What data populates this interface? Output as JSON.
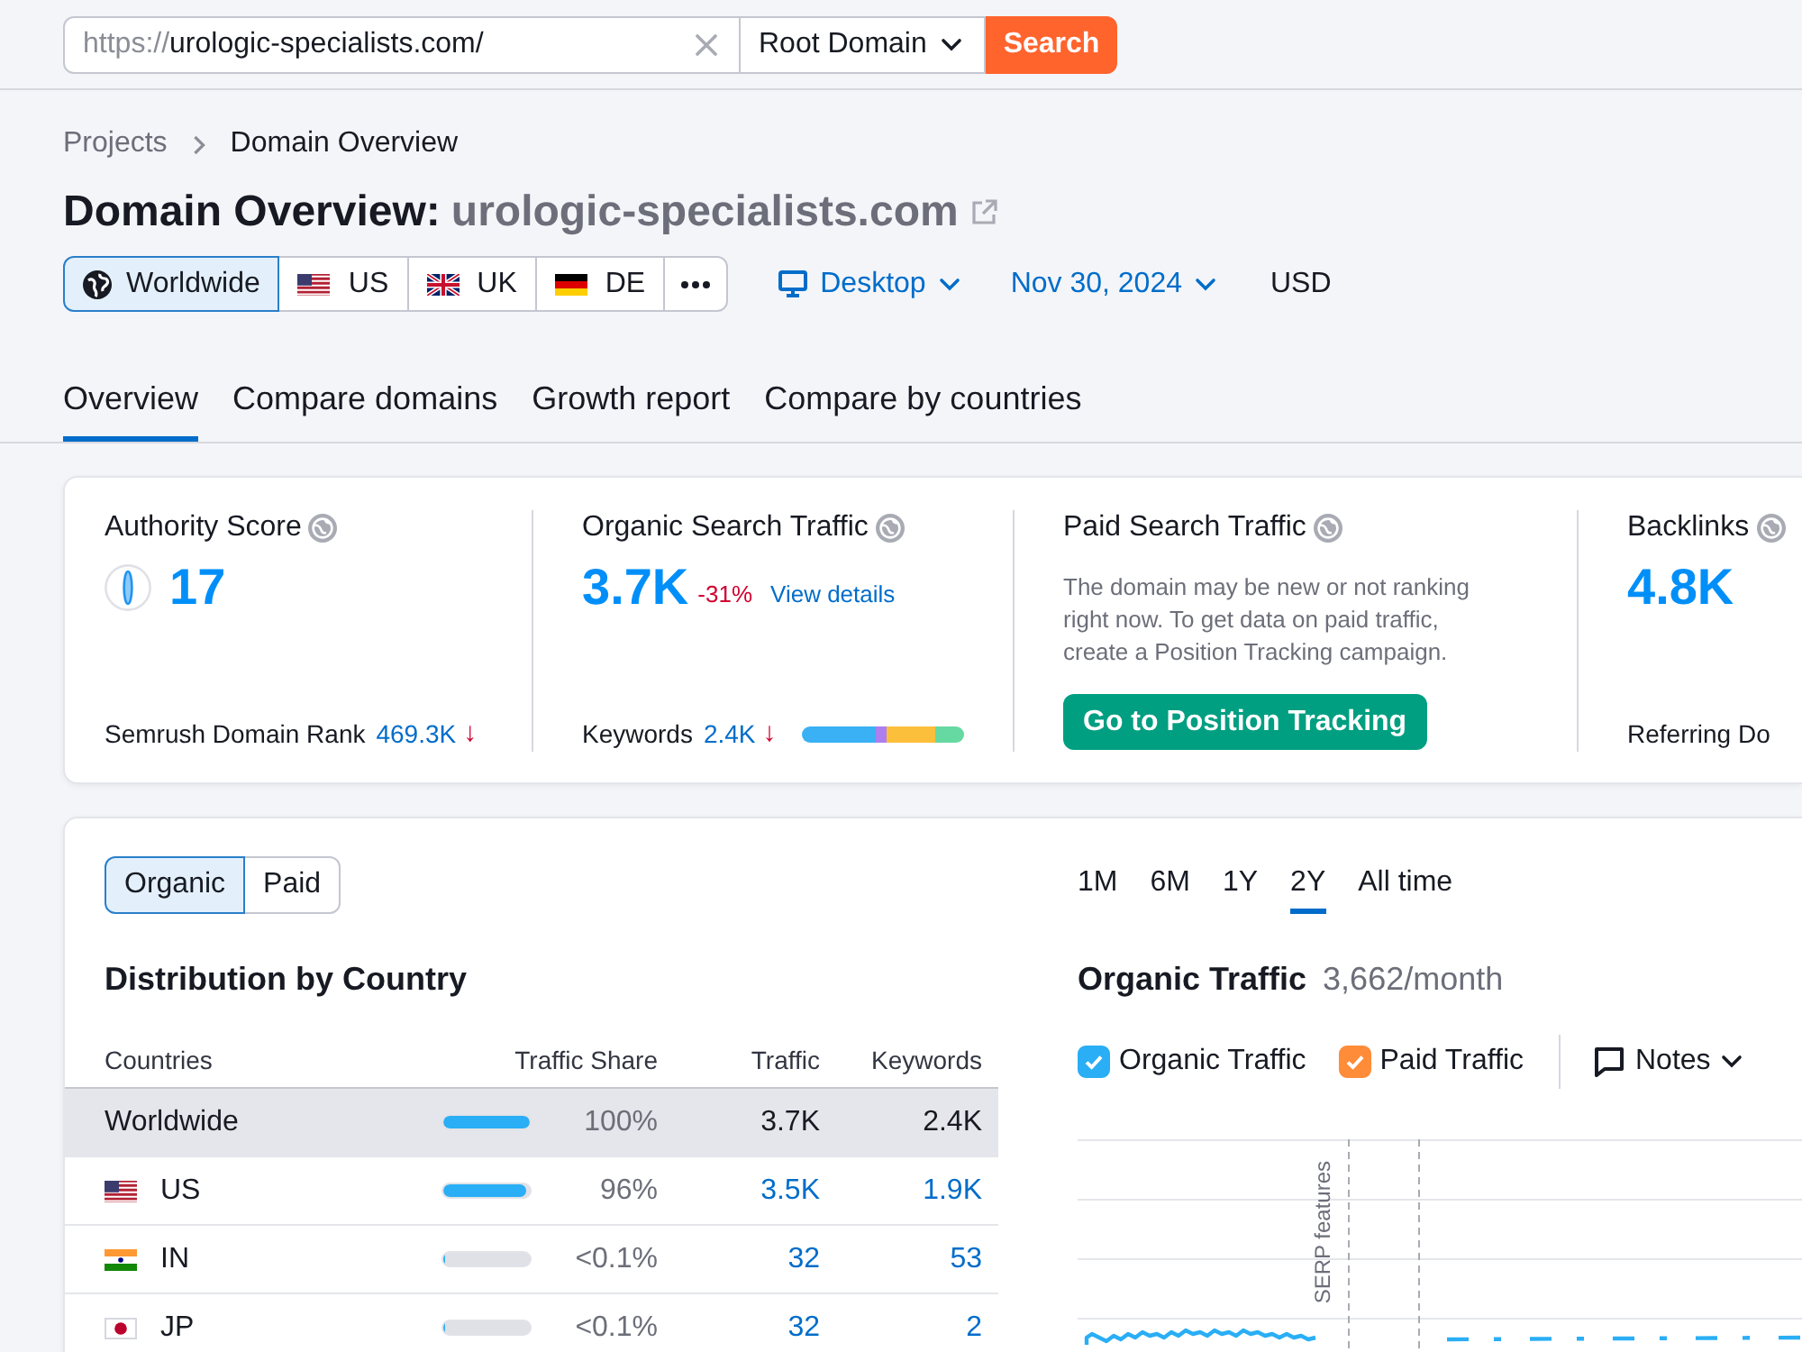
{
  "search": {
    "prefix": "https://",
    "value": "urologic-specialists.com/",
    "scope": "Root Domain",
    "button": "Search"
  },
  "breadcrumbs": [
    "Projects",
    "Domain Overview"
  ],
  "heading": {
    "title": "Domain Overview:",
    "domain": "urologic-specialists.com"
  },
  "databases": [
    {
      "kind": "globe",
      "label": "Worldwide",
      "selected": true
    },
    {
      "kind": "us",
      "label": "US",
      "selected": false
    },
    {
      "kind": "uk",
      "label": "UK",
      "selected": false
    },
    {
      "kind": "de",
      "label": "DE",
      "selected": false
    },
    {
      "kind": "more",
      "selected": false
    }
  ],
  "filters": {
    "device": "Desktop",
    "date": "Nov 30, 2024",
    "currency": "USD"
  },
  "tabs": [
    {
      "label": "Overview",
      "selected": true
    },
    {
      "label": "Compare domains",
      "selected": false
    },
    {
      "label": "Growth report",
      "selected": false
    },
    {
      "label": "Compare by countries",
      "selected": false
    }
  ],
  "metrics": [
    {
      "kind": "score",
      "title": "Authority Score",
      "value": "17",
      "footer_label": "Semrush Domain Rank",
      "footer_value": "469.3K",
      "footer_arrow": "↓"
    },
    {
      "kind": "traffic",
      "title": "Organic Search Traffic",
      "value": "3.7K",
      "change": "-31%",
      "link": "View details",
      "footer_label": "Keywords",
      "footer_value": "2.4K",
      "footer_arrow": "↓"
    },
    {
      "kind": "empty",
      "title": "Paid Search Traffic",
      "text": "The domain may be new or not ranking right now. To get data on paid traffic, create a Position Tracking campaign.",
      "button": "Go to Position Tracking"
    },
    {
      "kind": "count",
      "title": "Backlinks",
      "value": "4.8K",
      "footer_label": "Referring Do"
    }
  ],
  "traffic_types": [
    {
      "label": "Organic",
      "selected": true
    },
    {
      "label": "Paid",
      "selected": false
    }
  ],
  "distribution": {
    "title": "Distribution by Country",
    "columns": [
      "Countries",
      "Traffic Share",
      "Traffic",
      "Keywords"
    ],
    "rows": [
      {
        "kind": "total",
        "country": "Worldwide",
        "level": 1,
        "share": "100%",
        "traffic": "3.7K",
        "keywords": "2.4K"
      },
      {
        "kind": "us",
        "country": "US",
        "level": 0.96,
        "share": "96%",
        "traffic": "3.5K",
        "keywords": "1.9K"
      },
      {
        "kind": "in",
        "country": "IN",
        "level": 0.03,
        "share": "<0.1%",
        "traffic": "32",
        "keywords": "53"
      },
      {
        "kind": "jp",
        "country": "JP",
        "level": 0.03,
        "share": "<0.1%",
        "traffic": "32",
        "keywords": "2"
      }
    ]
  },
  "traffic_chart": {
    "periods": [
      {
        "label": "1M",
        "selected": false
      },
      {
        "label": "6M",
        "selected": false
      },
      {
        "label": "1Y",
        "selected": false
      },
      {
        "label": "2Y",
        "selected": true
      },
      {
        "label": "All time",
        "selected": false
      }
    ],
    "title": "Organic Traffic",
    "summary": "3,662/month",
    "legend": [
      {
        "label": "Organic Traffic",
        "checked": true,
        "color": "#2aaef5"
      },
      {
        "label": "Paid Traffic",
        "checked": true,
        "color": "#ff8c39"
      }
    ],
    "notes": "Notes",
    "marker_label": "SERP features"
  }
}
